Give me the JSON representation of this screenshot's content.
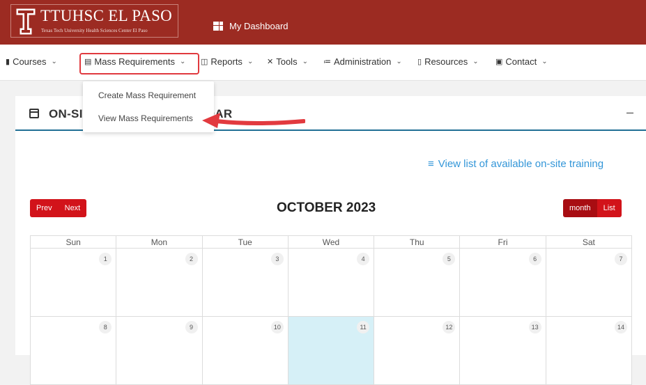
{
  "brand": {
    "title": "TTUHSC EL PASO",
    "subtitle": "Texas Tech University Health Sciences Center El Paso"
  },
  "topbar": {
    "dashboard_label": "My Dashboard"
  },
  "nav": {
    "courses": "Courses",
    "mass_requirements": "Mass Requirements",
    "reports": "Reports",
    "tools": "Tools",
    "administration": "Administration",
    "resources": "Resources",
    "contact": "Contact"
  },
  "dropdown": {
    "items": [
      "Create Mass Requirement",
      "View Mass Requirements"
    ]
  },
  "card": {
    "title": "ON-SITE TRAINING CALENDAR",
    "collapse_symbol": "–"
  },
  "calendar": {
    "list_link": "View list of available on-site training",
    "prev_label": "Prev",
    "next_label": "Next",
    "month_title": "OCTOBER 2023",
    "month_view_label": "month",
    "list_view_label": "List",
    "weekdays": [
      "Sun",
      "Mon",
      "Tue",
      "Wed",
      "Thu",
      "Fri",
      "Sat"
    ],
    "weeks": [
      [
        "1",
        "2",
        "3",
        "4",
        "5",
        "6",
        "7"
      ],
      [
        "8",
        "9",
        "10",
        "11",
        "12",
        "13",
        "14"
      ]
    ],
    "today": "11"
  },
  "colors": {
    "brand_red": "#9c2b22",
    "button_red": "#d2131a",
    "link_blue": "#3396d8",
    "today_bg": "#d6f0f7",
    "accent_teal": "#1f6f94",
    "highlight_red": "#e0393e"
  },
  "icons": {
    "dashboard": "dashboard-grid-icon",
    "courses": "book-icon",
    "mass_requirements": "clipboard-icon",
    "reports": "report-icon",
    "tools": "tools-icon",
    "administration": "users-icon",
    "resources": "library-icon",
    "contact": "contact-card-icon",
    "calendar": "calendar-icon",
    "list": "list-icon"
  }
}
